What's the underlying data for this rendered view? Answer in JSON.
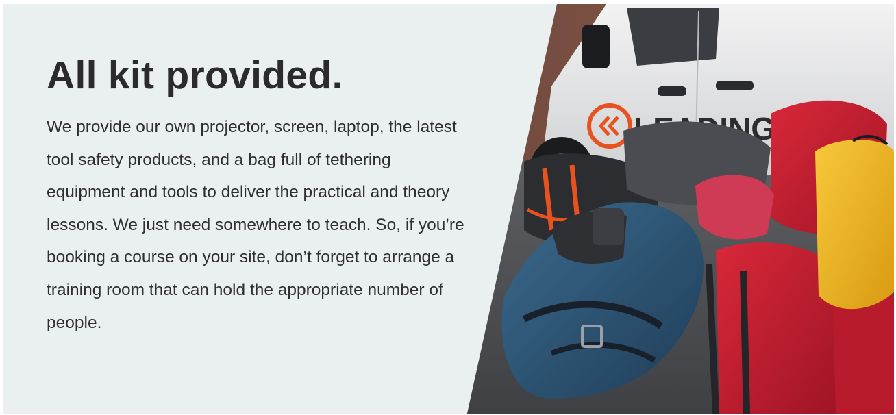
{
  "section": {
    "title": "All kit provided.",
    "body": "We provide our own projector, screen, laptop, the latest tool safety products, and a bag full of tethering equipment and tools to deliver the practical and theory lessons. We just need somewhere to teach. So, if you’re booking a course on your site, don’t forget to arrange a training room that can hold the appropriate number of people."
  },
  "photo": {
    "van_logo_text": "LEADINGEDGE",
    "colors": {
      "panel_bg": "#eaf0f0",
      "title": "#2b2a2d",
      "body": "#2f2e31",
      "brand_orange": "#e8521f",
      "van_white": "#e9e9ea",
      "bag_red": "#c8202d",
      "bag_yellow": "#f2b51c",
      "bag_blue": "#2f5878"
    }
  }
}
